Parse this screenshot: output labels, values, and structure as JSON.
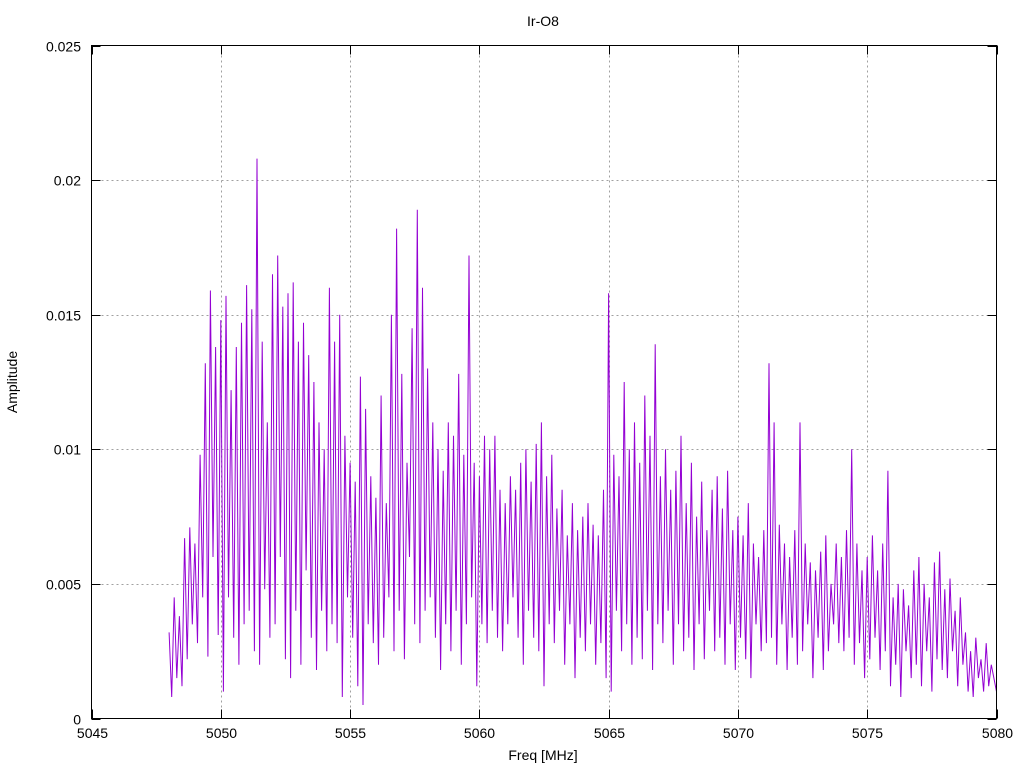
{
  "chart_data": {
    "type": "line",
    "title": "Ir-O8",
    "xlabel": "Freq [MHz]",
    "ylabel": "Amplitude",
    "xlim": [
      5045,
      5080
    ],
    "ylim": [
      0,
      0.025
    ],
    "xticks": [
      5045,
      5050,
      5055,
      5060,
      5065,
      5070,
      5075,
      5080
    ],
    "xtick_labels": [
      "5045",
      "5050",
      "5055",
      "5060",
      "5065",
      "5070",
      "5075",
      "5080"
    ],
    "yticks": [
      0,
      0.005,
      0.01,
      0.015,
      0.02,
      0.025
    ],
    "ytick_labels": [
      "0",
      "0.005",
      "0.01",
      "0.015",
      "0.02",
      "0.025"
    ],
    "grid": true,
    "legend": "none",
    "series": [
      {
        "name": "Ir-O8",
        "color": "#9400d3",
        "x_start": 5048.0,
        "x_step": 0.1,
        "values": [
          0.0032,
          0.0008,
          0.0045,
          0.0015,
          0.0038,
          0.0012,
          0.0067,
          0.0022,
          0.0071,
          0.0035,
          0.0065,
          0.0028,
          0.0098,
          0.0045,
          0.0132,
          0.0023,
          0.0159,
          0.006,
          0.0138,
          0.0031,
          0.0148,
          0.001,
          0.0157,
          0.0045,
          0.0122,
          0.003,
          0.0138,
          0.002,
          0.0147,
          0.0035,
          0.0161,
          0.004,
          0.0152,
          0.0025,
          0.0208,
          0.002,
          0.014,
          0.0048,
          0.011,
          0.003,
          0.0165,
          0.0035,
          0.0172,
          0.006,
          0.0153,
          0.0022,
          0.0158,
          0.0015,
          0.0162,
          0.004,
          0.014,
          0.002,
          0.0147,
          0.0055,
          0.0135,
          0.003,
          0.0125,
          0.0018,
          0.011,
          0.004,
          0.01,
          0.0025,
          0.016,
          0.0035,
          0.014,
          0.0028,
          0.015,
          0.0008,
          0.0105,
          0.0045,
          0.0095,
          0.003,
          0.0088,
          0.0012,
          0.0127,
          0.0005,
          0.0115,
          0.0035,
          0.009,
          0.0028,
          0.0082,
          0.002,
          0.012,
          0.003,
          0.008,
          0.0045,
          0.015,
          0.0025,
          0.0182,
          0.004,
          0.0128,
          0.0022,
          0.0095,
          0.006,
          0.0145,
          0.0035,
          0.0189,
          0.0028,
          0.016,
          0.004,
          0.013,
          0.0045,
          0.011,
          0.003,
          0.01,
          0.0018,
          0.0092,
          0.0035,
          0.011,
          0.0025,
          0.0105,
          0.004,
          0.0128,
          0.002,
          0.0098,
          0.0035,
          0.0172,
          0.0045,
          0.0095,
          0.0012,
          0.009,
          0.0035,
          0.0105,
          0.0028,
          0.01,
          0.004,
          0.0105,
          0.003,
          0.0085,
          0.0025,
          0.008,
          0.0035,
          0.009,
          0.0045,
          0.0085,
          0.003,
          0.0095,
          0.002,
          0.01,
          0.004,
          0.0088,
          0.003,
          0.0102,
          0.0025,
          0.011,
          0.0012,
          0.009,
          0.0035,
          0.0098,
          0.0028,
          0.0078,
          0.004,
          0.0085,
          0.002,
          0.0068,
          0.0035,
          0.008,
          0.0015,
          0.007,
          0.003,
          0.0075,
          0.0025,
          0.008,
          0.0035,
          0.0072,
          0.002,
          0.0068,
          0.0028,
          0.0085,
          0.0015,
          0.0158,
          0.001,
          0.0098,
          0.004,
          0.009,
          0.0025,
          0.0125,
          0.0035,
          0.01,
          0.002,
          0.011,
          0.003,
          0.0095,
          0.0022,
          0.012,
          0.004,
          0.0105,
          0.0018,
          0.0139,
          0.0035,
          0.009,
          0.0028,
          0.01,
          0.004,
          0.0085,
          0.002,
          0.0092,
          0.0035,
          0.0105,
          0.0025,
          0.008,
          0.003,
          0.0095,
          0.0018,
          0.0075,
          0.0035,
          0.0088,
          0.0022,
          0.007,
          0.004,
          0.0085,
          0.0025,
          0.009,
          0.003,
          0.0078,
          0.002,
          0.0092,
          0.0035,
          0.007,
          0.0018,
          0.0075,
          0.003,
          0.0068,
          0.0022,
          0.008,
          0.0015,
          0.0065,
          0.0035,
          0.006,
          0.0025,
          0.007,
          0.0028,
          0.0132,
          0.003,
          0.011,
          0.002,
          0.0072,
          0.0035,
          0.0065,
          0.0018,
          0.006,
          0.003,
          0.007,
          0.002,
          0.011,
          0.0025,
          0.0065,
          0.0035,
          0.0058,
          0.0015,
          0.0055,
          0.003,
          0.0062,
          0.0018,
          0.0068,
          0.0025,
          0.005,
          0.0035,
          0.0065,
          0.0028,
          0.006,
          0.0025,
          0.007,
          0.003,
          0.01,
          0.002,
          0.0065,
          0.0028,
          0.0055,
          0.0015,
          0.006,
          0.0022,
          0.0068,
          0.003,
          0.0055,
          0.0018,
          0.0065,
          0.0025,
          0.0092,
          0.0012,
          0.0045,
          0.002,
          0.005,
          0.0008,
          0.0048,
          0.0025,
          0.0042,
          0.0015,
          0.0055,
          0.002,
          0.006,
          0.0012,
          0.005,
          0.0025,
          0.0045,
          0.001,
          0.0058,
          0.0022,
          0.0062,
          0.0018,
          0.0048,
          0.0015,
          0.0052,
          0.0025,
          0.004,
          0.0012,
          0.0045,
          0.002,
          0.0032,
          0.001,
          0.0025,
          0.0008,
          0.003,
          0.0015,
          0.0022,
          0.001,
          0.0028,
          0.0012,
          0.002,
          0.0015,
          0.001
        ]
      }
    ]
  }
}
